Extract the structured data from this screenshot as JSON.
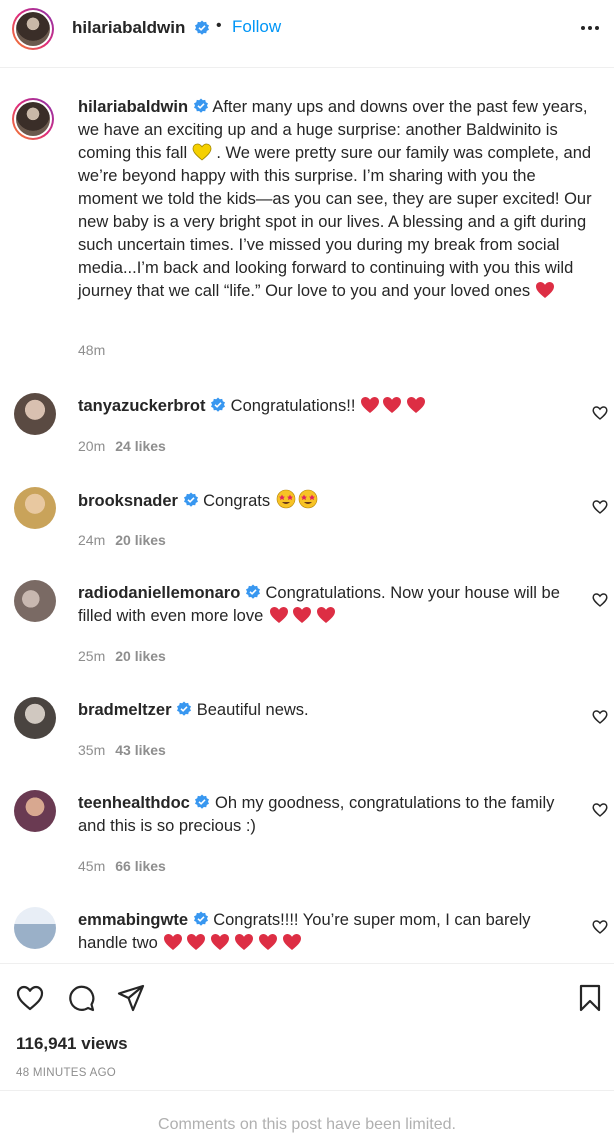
{
  "header": {
    "username": "hilariabaldwin",
    "separator": "•",
    "follow_label": "Follow",
    "more_icon": "more-horizontal-icon"
  },
  "caption": {
    "username": "hilariabaldwin",
    "text_part1": "After many ups and downs over the past few years, we have an exciting up and a huge surprise: another Baldwinito is coming this fall",
    "text_part2": ". We were pretty sure our family was complete, and we’re beyond happy with this surprise. I’m sharing with you the moment we told the kids—as you can see, they are super excited! Our new baby is a very bright spot in our lives. A blessing and a gift during such uncertain times. I’ve missed you during my break from social media...I’m back and looking forward to continuing with you this wild journey that we call “life.” Our love to you and your loved ones",
    "time": "48m"
  },
  "comments": [
    {
      "username": "tanyazuckerbrot",
      "text": "Congratulations!!",
      "time": "20m",
      "likes": "24 likes",
      "avatar_color": "#5a4a42"
    },
    {
      "username": "brooksnader",
      "text": "Congrats",
      "time": "24m",
      "likes": "20 likes",
      "avatar_color": "#c9a35a"
    },
    {
      "username": "radiodaniellemonaro",
      "text": "Congratulations. Now your house will be filled with even more love",
      "time": "25m",
      "likes": "20 likes",
      "avatar_color": "#7a6a64"
    },
    {
      "username": "bradmeltzer",
      "text": "Beautiful news.",
      "time": "35m",
      "likes": "43 likes",
      "avatar_color": "#4a4440"
    },
    {
      "username": "teenhealthdoc",
      "text": "Oh my goodness, congratulations to the family and this is so precious :)",
      "time": "45m",
      "likes": "66 likes",
      "avatar_color": "#6a3a52"
    },
    {
      "username": "emmabingwte",
      "text": "Congrats!!!! You’re super mom, I can barely handle two",
      "time": "",
      "likes": "",
      "avatar_color": "#9ab0c8"
    }
  ],
  "footer": {
    "views": "116,941 views",
    "ago": "48 MINUTES AGO",
    "limited_notice": "Comments on this post have been limited."
  },
  "colors": {
    "follow_blue": "#0095f6",
    "verified_blue": "#3897f0",
    "heart_red": "#dd2e44",
    "muted": "#8e8e8e"
  }
}
